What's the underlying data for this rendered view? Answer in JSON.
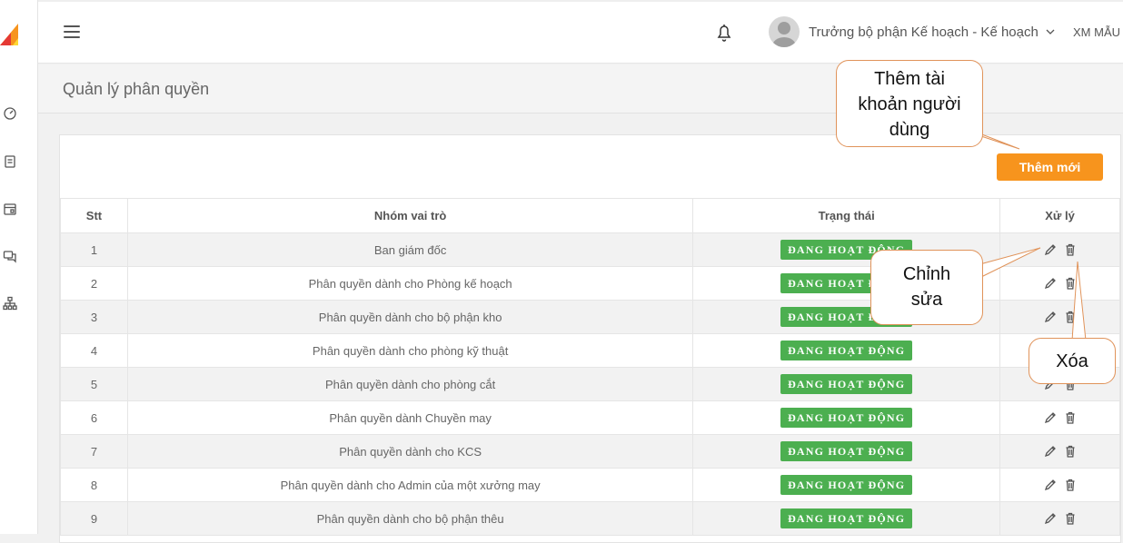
{
  "header": {
    "user_name": "Trưởng bộ phận Kế hoạch - Kế hoạch",
    "unit": "XM MẪU"
  },
  "page": {
    "title": "Quản lý phân quyền",
    "add_button": "Thêm mới"
  },
  "table": {
    "columns": [
      "Stt",
      "Nhóm vai trò",
      "Trạng thái",
      "Xử lý"
    ],
    "rows": [
      {
        "stt": "1",
        "role": "Ban giám đốc",
        "status": "ĐANG HOẠT ĐỘNG"
      },
      {
        "stt": "2",
        "role": "Phân quyền dành cho Phòng kế hoạch",
        "status": "ĐANG HOẠT ĐỘNG"
      },
      {
        "stt": "3",
        "role": "Phân quyền dành cho bộ phận kho",
        "status": "ĐANG HOẠT ĐỘNG"
      },
      {
        "stt": "4",
        "role": "Phân quyền dành cho phòng kỹ thuật",
        "status": "ĐANG HOẠT ĐỘNG"
      },
      {
        "stt": "5",
        "role": "Phân quyền dành cho phòng cắt",
        "status": "ĐANG HOẠT ĐỘNG"
      },
      {
        "stt": "6",
        "role": "Phân quyền dành Chuyền may",
        "status": "ĐANG HOẠT ĐỘNG"
      },
      {
        "stt": "7",
        "role": "Phân quyền dành cho KCS",
        "status": "ĐANG HOẠT ĐỘNG"
      },
      {
        "stt": "8",
        "role": "Phân quyền dành cho Admin của một xưởng may",
        "status": "ĐANG HOẠT ĐỘNG"
      },
      {
        "stt": "9",
        "role": "Phân quyền dành cho bộ phận thêu",
        "status": "ĐANG HOẠT ĐỘNG"
      }
    ]
  },
  "callouts": {
    "add": [
      "Thêm tài",
      "khoản người",
      "dùng"
    ],
    "edit": [
      "Chỉnh",
      "sửa"
    ],
    "delete": "Xóa"
  },
  "icons": {
    "sidebar": [
      "dashboard-icon",
      "document-icon",
      "calendar-icon",
      "chat-icon",
      "sitemap-icon"
    ],
    "topbar": [
      "menu-icon",
      "bell-icon",
      "avatar-icon",
      "chevron-down-icon"
    ],
    "row_actions": [
      "pencil-icon",
      "trash-icon"
    ]
  },
  "colors": {
    "accent_orange": "#f7941d",
    "status_green": "#4caf50",
    "callout_border": "#e0935a"
  }
}
